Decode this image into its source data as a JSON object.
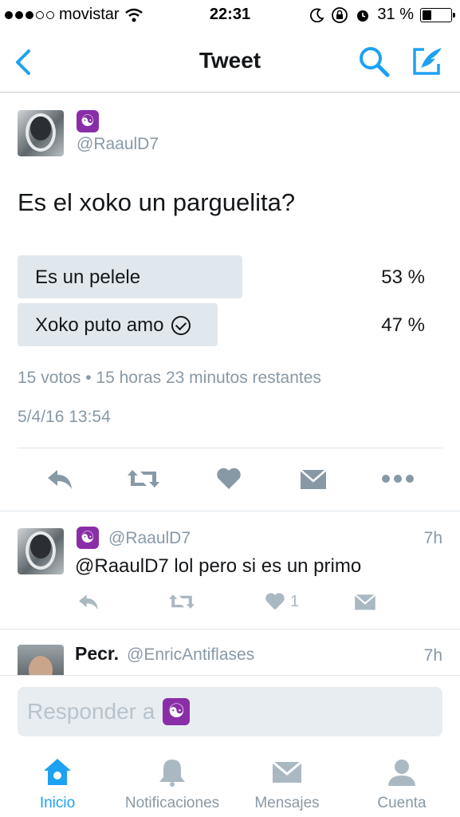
{
  "status_bar": {
    "carrier": "movistar",
    "time": "22:31",
    "battery": "31 %",
    "battery_level": 0.31
  },
  "nav": {
    "title": "Tweet",
    "icons": [
      "back-icon",
      "search-icon",
      "compose-icon"
    ]
  },
  "tweet": {
    "handle": "@RaaulD7",
    "name_icon": "yin-yang-icon",
    "text": "Es el xoko un parguelita?",
    "poll": [
      {
        "label": "Es un pelele",
        "percent": "53 %",
        "value": 0.53,
        "selected": false
      },
      {
        "label": "Xoko puto amo",
        "percent": "47 %",
        "value": 0.47,
        "selected": true
      }
    ],
    "poll_meta": "15 votos • 15 horas 23 minutos restantes",
    "date": "5/4/16 13:54",
    "actions": [
      "reply-icon",
      "retweet-icon",
      "like-icon",
      "message-icon",
      "more-icon"
    ]
  },
  "replies": [
    {
      "handle": "@RaaulD7",
      "time": "7h",
      "text": "@RaaulD7 lol pero si es un primo",
      "likes": "1"
    },
    {
      "name": "Pecr.",
      "handle": "@EnricAntiflases",
      "time": "7h"
    }
  ],
  "compose": {
    "placeholder": "Responder a"
  },
  "tabs": [
    {
      "label": "Inicio",
      "icon": "home-icon",
      "active": true
    },
    {
      "label": "Notificaciones",
      "icon": "bell-icon",
      "active": false
    },
    {
      "label": "Mensajes",
      "icon": "envelope-icon",
      "active": false
    },
    {
      "label": "Cuenta",
      "icon": "person-icon",
      "active": false
    }
  ],
  "colors": {
    "accent": "#1da1f2",
    "muted": "#8899a6",
    "poll_bar": "#e1e8ed"
  }
}
